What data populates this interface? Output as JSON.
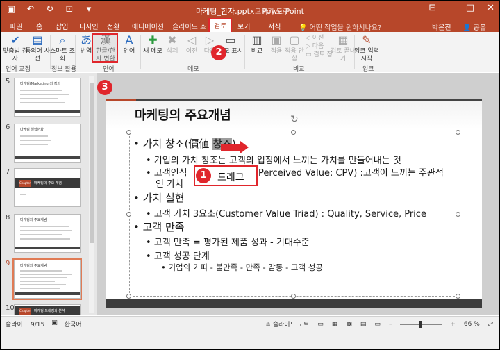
{
  "window": {
    "title": "마케팅_한자.pptx - PowerPoint",
    "context_title": "그리기 도구"
  },
  "tabs": [
    {
      "label": "파일"
    },
    {
      "label": "홈"
    },
    {
      "label": "삽입"
    },
    {
      "label": "디자인"
    },
    {
      "label": "전환"
    },
    {
      "label": "애니메이션"
    },
    {
      "label": "슬라이드 쇼"
    },
    {
      "label": "검토",
      "active": true
    },
    {
      "label": "보기"
    },
    {
      "label": "서식"
    }
  ],
  "tell_me": "어떤 작업을 원하시나요?",
  "user_name": "박은진",
  "share_label": "공유",
  "ribbon": {
    "proofing": {
      "spell": "맞춤법 검사",
      "thesaurus": "동의어 사전",
      "group": "언어 교정"
    },
    "insights": {
      "smart_lookup": "스마트 조회",
      "group": "정보 활용"
    },
    "language": {
      "translate": "번역",
      "hanja": "한글/한자 변환",
      "lang": "언어",
      "group": "언어"
    },
    "comments": {
      "new": "새 메모",
      "delete": "삭제",
      "prev": "이전",
      "next": "다음",
      "show": "메모 표시",
      "group": "메모"
    },
    "compare": {
      "compare": "비교",
      "accept": "적용",
      "reject": "적용 안 함",
      "prev": "이전",
      "next": "다음",
      "pane": "검토 창",
      "end": "검토 끝내기",
      "group": "비교"
    },
    "ink": {
      "start": "잉크 입력 시작",
      "group": "잉크"
    }
  },
  "callouts": {
    "c1": "1",
    "c2": "2",
    "c3": "3",
    "drag": "드래그"
  },
  "thumbnails": [
    {
      "num": "5",
      "title": "마케팅(Marketing)의 정의"
    },
    {
      "num": "6",
      "title": "마케팅 철학변화"
    },
    {
      "num": "7",
      "title": "마케팅의 주요 개념",
      "tag": "Chapter"
    },
    {
      "num": "8",
      "title": "마케팅의 주요개념"
    },
    {
      "num": "9",
      "title": "마케팅의 주요개념",
      "selected": true
    },
    {
      "num": "10",
      "title": "마케팅 트래킹과 분석",
      "tag": "Chapter"
    }
  ],
  "slide": {
    "title": "마케팅의 주요개념",
    "b1": "• 가치 창조(價値 ",
    "b1_sel": "창조",
    "b1_end": ")",
    "b1a": "• 기업의 가치 창조는 고객의 입장에서 느끼는 가치를 만들어내는 것",
    "b1b_start": "• 고객인식",
    "b1b_end": "Perceived Value: CPV) :고객이 느끼는 주관적",
    "b1b_cont": "인 가치",
    "b2": "• 가치 실현",
    "b2a": "• 고객 가치 3요소(Customer Value Triad) : Quality, Service, Price",
    "b3": "• 고객 만족",
    "b3a": "• 고객 만족 = 평가된 제품 성과 - 기대수준",
    "b3b": "• 고객 성공 단계",
    "b3c": "• 기업의 기피 - 불만족 - 만족 - 감동 - 고객 성공"
  },
  "status": {
    "slide_count": "슬라이드 9/15",
    "language": "한국어",
    "notes": "슬라이드 노트",
    "zoom": "66 %"
  }
}
